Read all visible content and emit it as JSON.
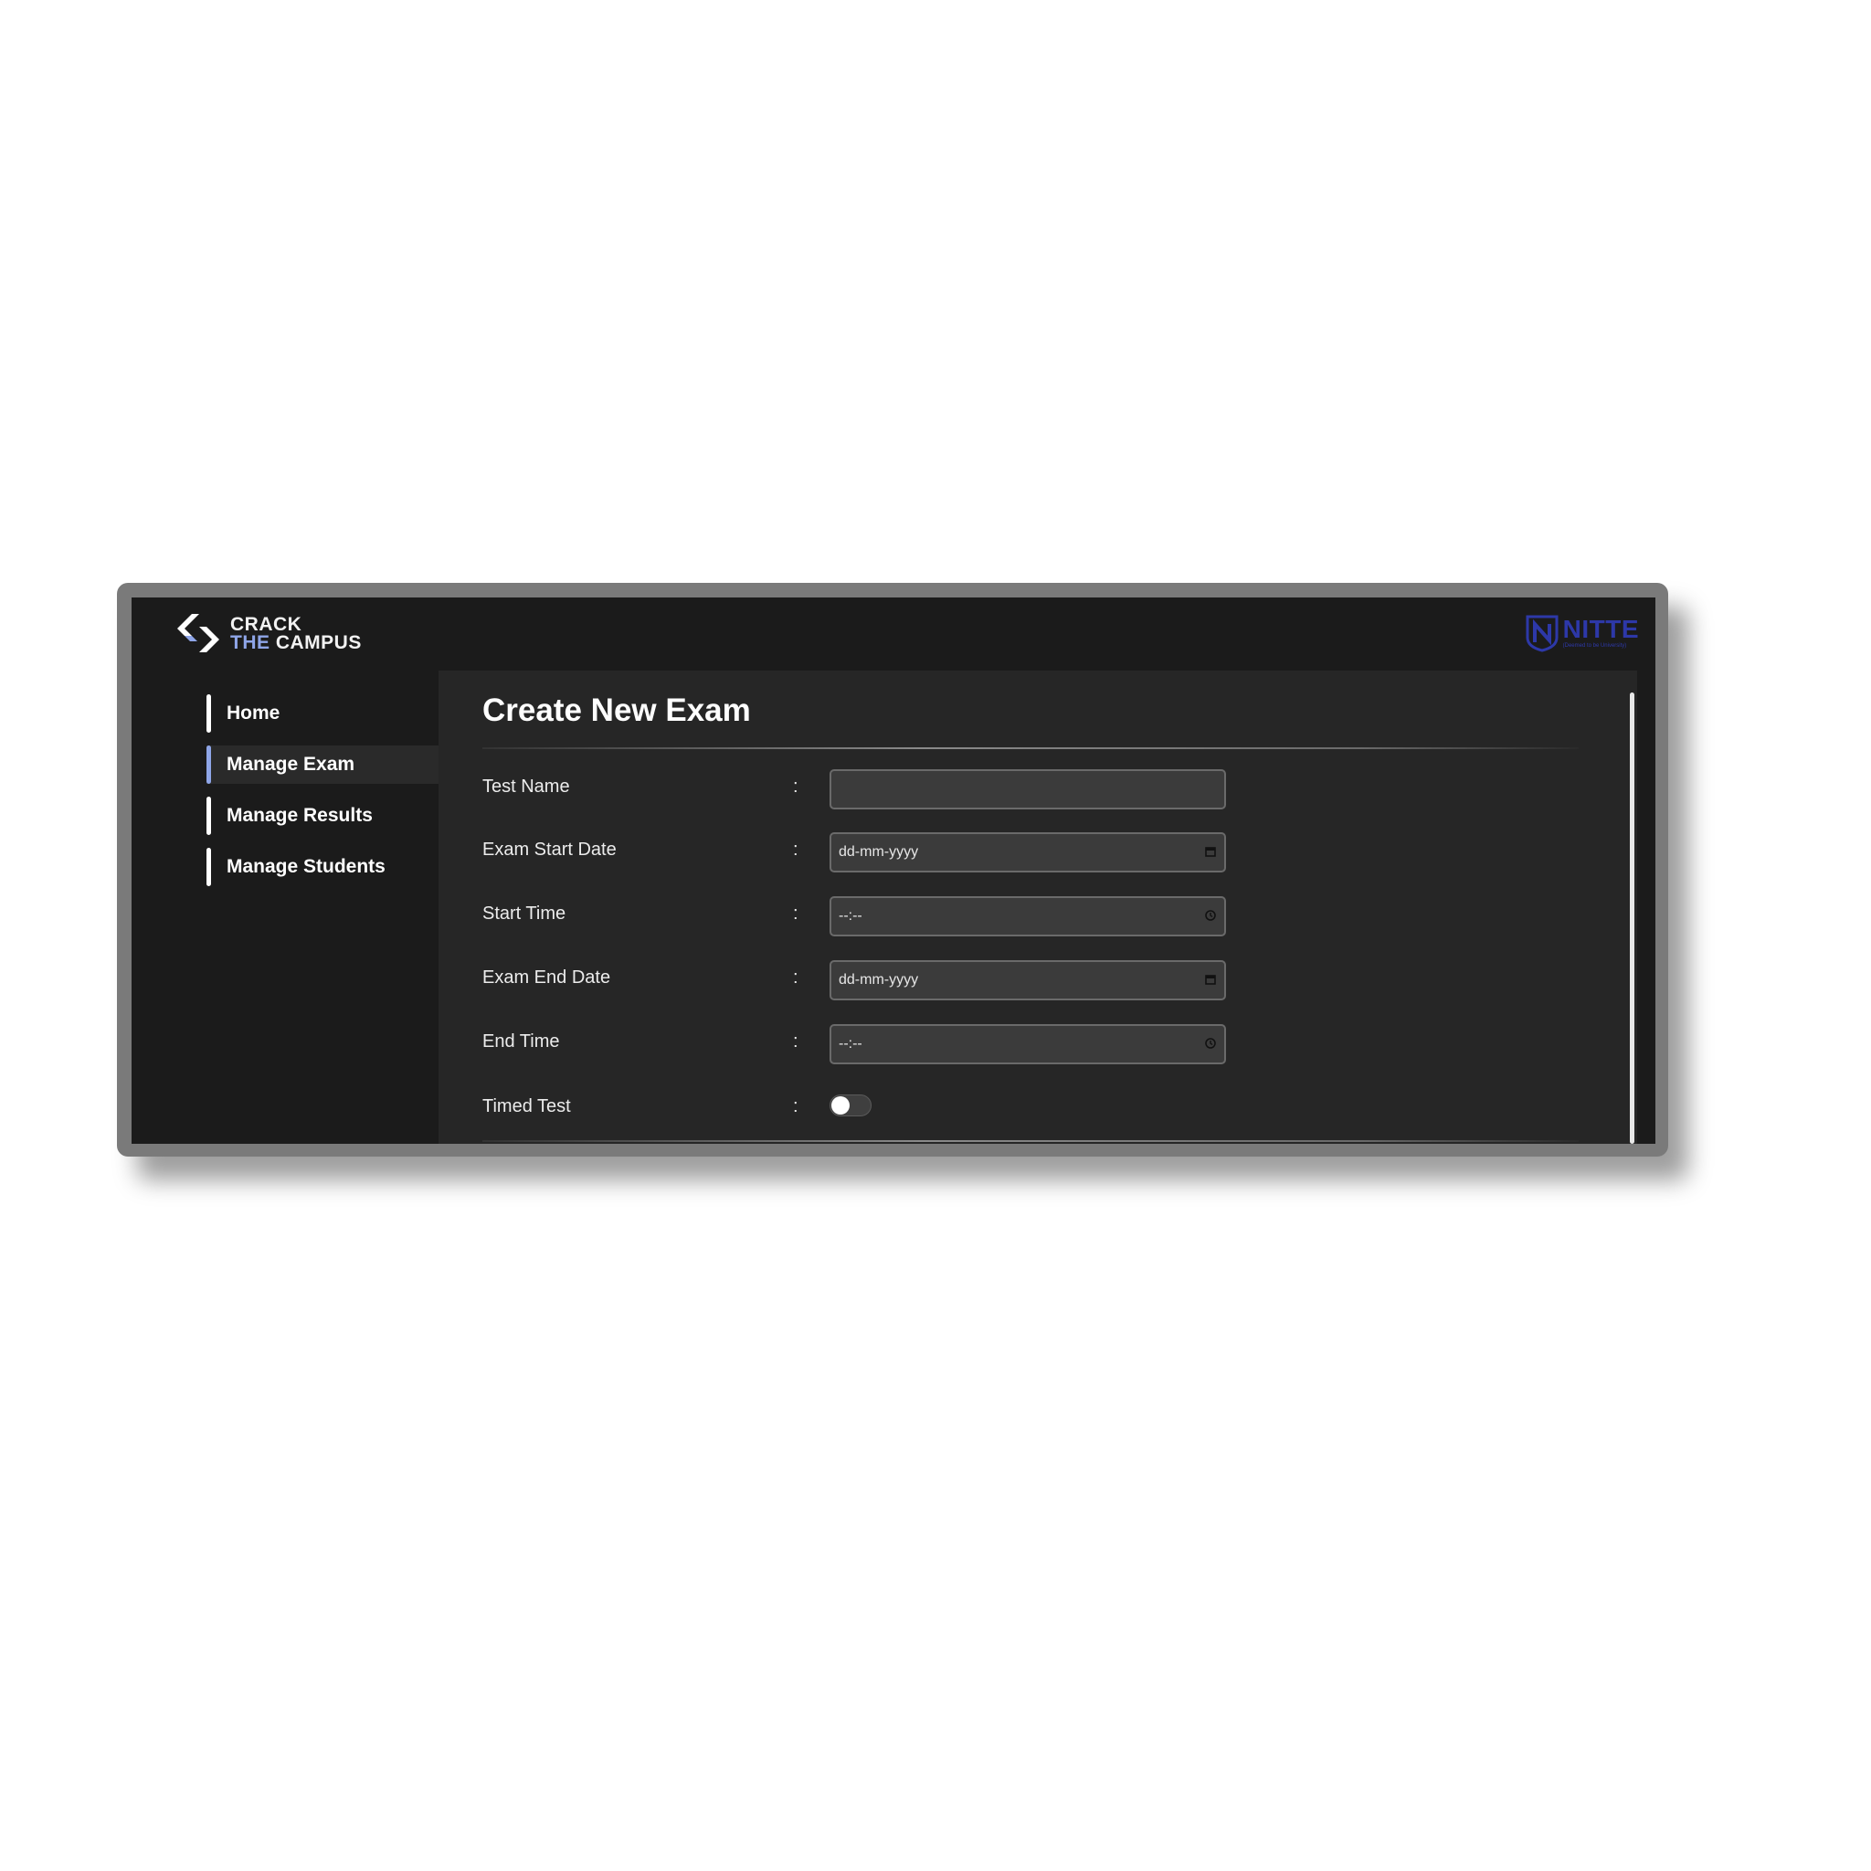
{
  "brand": {
    "line1": "CRACK",
    "line2_accent": "THE",
    "line2_rest": " CAMPUS",
    "icon": "crack-the-campus-logo"
  },
  "partner_logo": {
    "name": "NITTE",
    "subtitle": "(Deemed to be University)",
    "icon": "nitte-logo"
  },
  "sidebar": {
    "items": [
      {
        "label": "Home",
        "active": false
      },
      {
        "label": "Manage Exam",
        "active": true
      },
      {
        "label": "Manage Results",
        "active": false
      },
      {
        "label": "Manage Students",
        "active": false
      }
    ]
  },
  "form": {
    "title": "Create New Exam",
    "separator": ":",
    "fields": {
      "test_name": {
        "label": "Test Name",
        "value": "",
        "placeholder": ""
      },
      "exam_start_date": {
        "label": "Exam Start Date",
        "placeholder": "dd-mm-yyyy",
        "icon": "calendar-icon"
      },
      "start_time": {
        "label": "Start Time",
        "placeholder": "--:--",
        "icon": "clock-icon"
      },
      "exam_end_date": {
        "label": "Exam End Date",
        "placeholder": "dd-mm-yyyy",
        "icon": "calendar-icon"
      },
      "end_time": {
        "label": "End Time",
        "placeholder": "--:--",
        "icon": "clock-icon"
      },
      "timed_test": {
        "label": "Timed Test",
        "enabled": false
      }
    }
  },
  "colors": {
    "accent": "#8fa6e8",
    "partner": "#2d38a8",
    "background": "#1b1b1b",
    "panel": "#262626"
  }
}
